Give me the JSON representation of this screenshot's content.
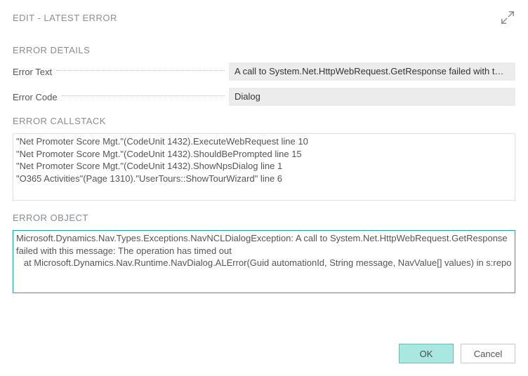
{
  "header": {
    "title": "EDIT - LATEST ERROR"
  },
  "errorDetails": {
    "sectionTitle": "ERROR DETAILS",
    "errorTextLabel": "Error Text",
    "errorTextValue": "A call to System.Net.HttpWebRequest.GetResponse failed with t…",
    "errorCodeLabel": "Error Code",
    "errorCodeValue": "Dialog"
  },
  "callstack": {
    "sectionTitle": "ERROR CALLSTACK",
    "content": "\"Net Promoter Score Mgt.\"(CodeUnit 1432).ExecuteWebRequest line 10\n\"Net Promoter Score Mgt.\"(CodeUnit 1432).ShouldBePrompted line 15\n\"Net Promoter Score Mgt.\"(CodeUnit 1432).ShowNpsDialog line 1\n\"O365 Activities\"(Page 1310).\"UserTours::ShowTourWizard\" line 6"
  },
  "errorObject": {
    "sectionTitle": "ERROR OBJECT",
    "content": "Microsoft.Dynamics.Nav.Types.Exceptions.NavNCLDialogException: A call to System.Net.HttpWebRequest.GetResponse failed with this message: The operation has timed out\n   at Microsoft.Dynamics.Nav.Runtime.NavDialog.ALError(Guid automationId, String message, NavValue[] values) in s:repo"
  },
  "buttons": {
    "ok": "OK",
    "cancel": "Cancel"
  }
}
